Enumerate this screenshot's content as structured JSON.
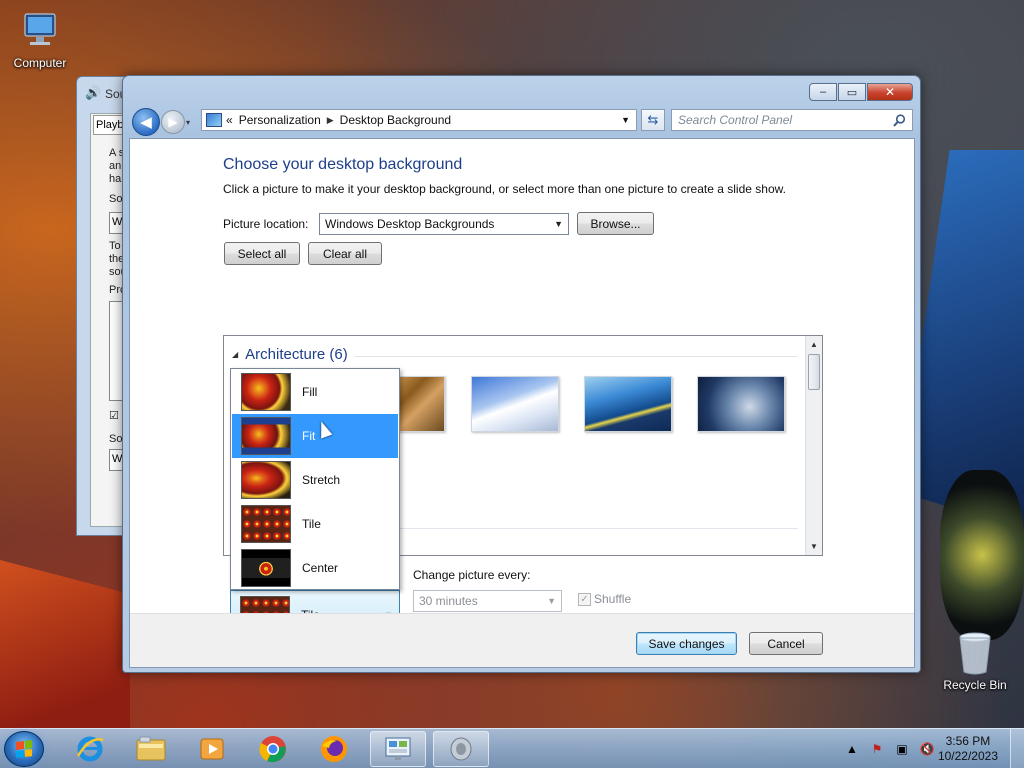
{
  "desktop": {
    "icons": [
      {
        "label": "Computer",
        "icon": "computer-icon"
      },
      {
        "label": "Recycle Bin",
        "icon": "recycle-bin-icon"
      }
    ]
  },
  "back_window": {
    "title": "Sou",
    "tab": "Playb",
    "lines": [
      "A s",
      "an",
      "ha",
      "So",
      "W",
      "To",
      "the",
      "sou",
      "Pro",
      "So",
      "W"
    ]
  },
  "window": {
    "controls": {
      "minimize": "–",
      "maximize": "▭",
      "close": "✕"
    },
    "nav": {
      "back_glyph": "◀",
      "forward_glyph": "▶",
      "history_glyph": "▾"
    },
    "address": {
      "prefix": "«",
      "breadcrumbs": [
        "Personalization",
        "Desktop Background"
      ],
      "separator": "▶"
    },
    "search": {
      "placeholder": "Search Control Panel"
    },
    "heading": "Choose your desktop background",
    "subheading": "Click a picture to make it your desktop background, or select more than one picture to create a slide show.",
    "picture_location": {
      "label": "Picture location:",
      "value": "Windows Desktop Backgrounds",
      "browse": "Browse..."
    },
    "select_all": "Select all",
    "clear_all": "Clear all",
    "gallery": {
      "group_title": "Architecture (6)",
      "thumbnails": [
        "architecture-photo-1",
        "architecture-photo-2",
        "architecture-photo-3",
        "architecture-photo-4"
      ]
    },
    "picture_position": {
      "options": [
        "Fill",
        "Fit",
        "Stretch",
        "Tile",
        "Center"
      ],
      "highlighted": "Fit",
      "selected": "Tile"
    },
    "slideshow": {
      "change_label": "Change picture every:",
      "interval": "30 minutes",
      "shuffle_label": "Shuffle",
      "shuffle_checked": true
    },
    "footer": {
      "save": "Save changes",
      "cancel": "Cancel"
    }
  },
  "taskbar": {
    "pinned": [
      {
        "name": "internet-explorer",
        "active": false
      },
      {
        "name": "file-explorer",
        "active": false
      },
      {
        "name": "media-player",
        "active": false
      },
      {
        "name": "chrome",
        "active": false
      },
      {
        "name": "firefox",
        "active": false
      },
      {
        "name": "control-panel",
        "active": true
      },
      {
        "name": "sound",
        "active": true
      }
    ],
    "tray": {
      "time": "3:56 PM",
      "date": "10/22/2023"
    }
  },
  "colors": {
    "heading_blue": "#1e3f8a",
    "selection_blue": "#3399ff",
    "close_red": "#c9432e"
  }
}
